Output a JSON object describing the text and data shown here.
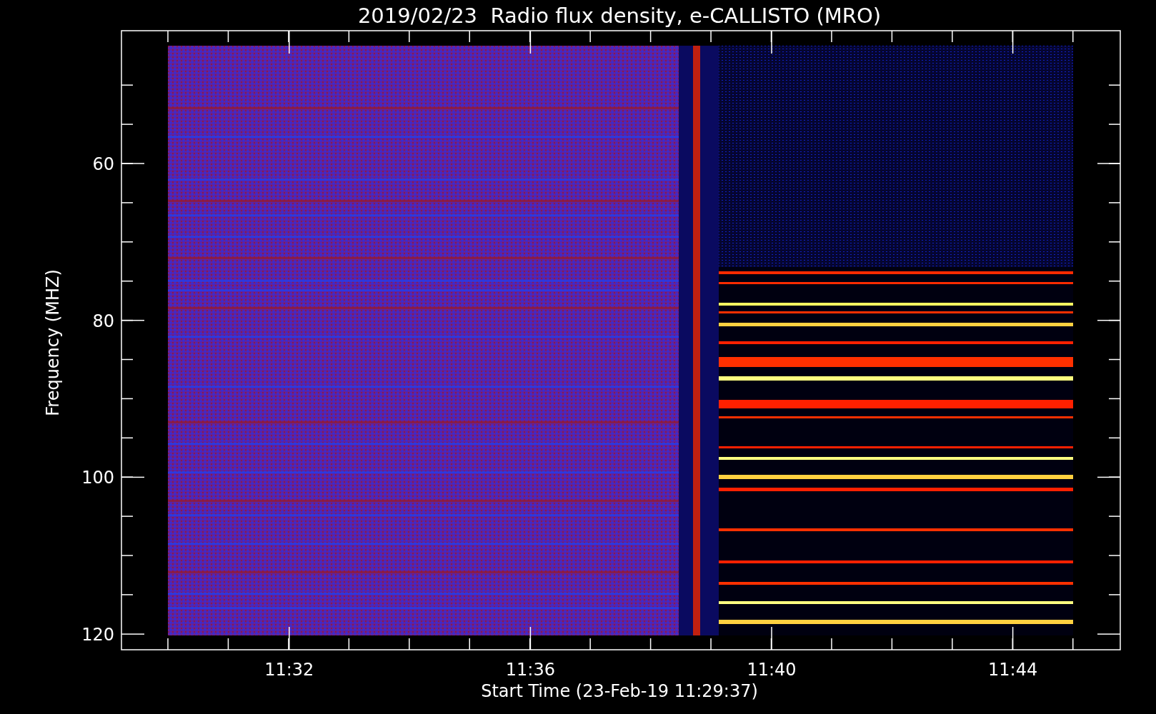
{
  "plot": {
    "title": "2019/02/23  Radio flux density, e-CALLISTO (MRO)",
    "ylabel": "Frequency (MHZ)",
    "xlabel": "Start Time (23-Feb-19 11:29:37)",
    "yticks": [
      "60",
      "80",
      "100",
      "120"
    ],
    "xticks": [
      "11:32",
      "11:36",
      "11:40",
      "11:44"
    ]
  }
}
